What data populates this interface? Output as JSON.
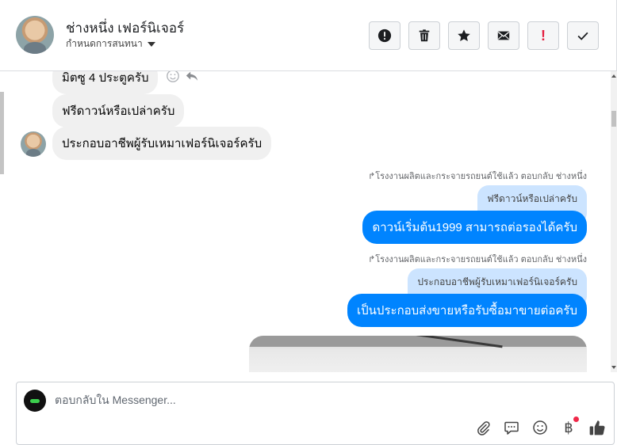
{
  "header": {
    "name": "ช่างหนึ่ง เฟอร์นิเจอร์",
    "subtitle": "กำหนดการสนทนา",
    "actions": [
      {
        "name": "mark-spam-button",
        "icon": "alert-circle-icon"
      },
      {
        "name": "delete-button",
        "icon": "trash-icon"
      },
      {
        "name": "star-button",
        "icon": "star-icon"
      },
      {
        "name": "mark-unread-button",
        "icon": "envelope-icon"
      },
      {
        "name": "priority-button",
        "icon": "exclamation-icon",
        "label": "!"
      },
      {
        "name": "done-button",
        "icon": "check-icon"
      }
    ]
  },
  "messages": {
    "m1": "มิตซู 4 ประตูครับ",
    "m2": "ฟรีดาวน์หรือเปล่าครับ",
    "m3": "ประกอบอาชีพผู้รับเหมาเฟอร์นิเจอร์ครับ",
    "reply1_meta": "โรงงานผลิตและกระจายรถยนต์ใช้แล้ว ตอบกลับ ช่างหนึ่ง",
    "reply1_quote": "ฟรีดาวน์หรือเปล่าครับ",
    "reply1_text": "ดาวน์เริ่มต้น1999 สามารถต่อรองได้ครับ",
    "reply2_meta": "โรงงานผลิตและกระจายรถยนต์ใช้แล้ว ตอบกลับ ช่างหนึ่ง",
    "reply2_quote": "ประกอบอาชีพผู้รับเหมาเฟอร์นิเจอร์ครับ",
    "reply2_text": "เป็นประกอบส่งขายหรือรับซื้อมาขายต่อครับ"
  },
  "composer": {
    "placeholder": "ตอบกลับใน Messenger...",
    "baht_symbol": "฿",
    "icons": [
      "paperclip-icon",
      "speech-bubble-icon",
      "smiley-icon",
      "baht-icon",
      "thumbs-up-icon"
    ]
  },
  "colors": {
    "outgoing": "#0084ff",
    "quote": "#cce4ff",
    "incoming": "#f0f0f0",
    "thumb": "#0084ff"
  }
}
